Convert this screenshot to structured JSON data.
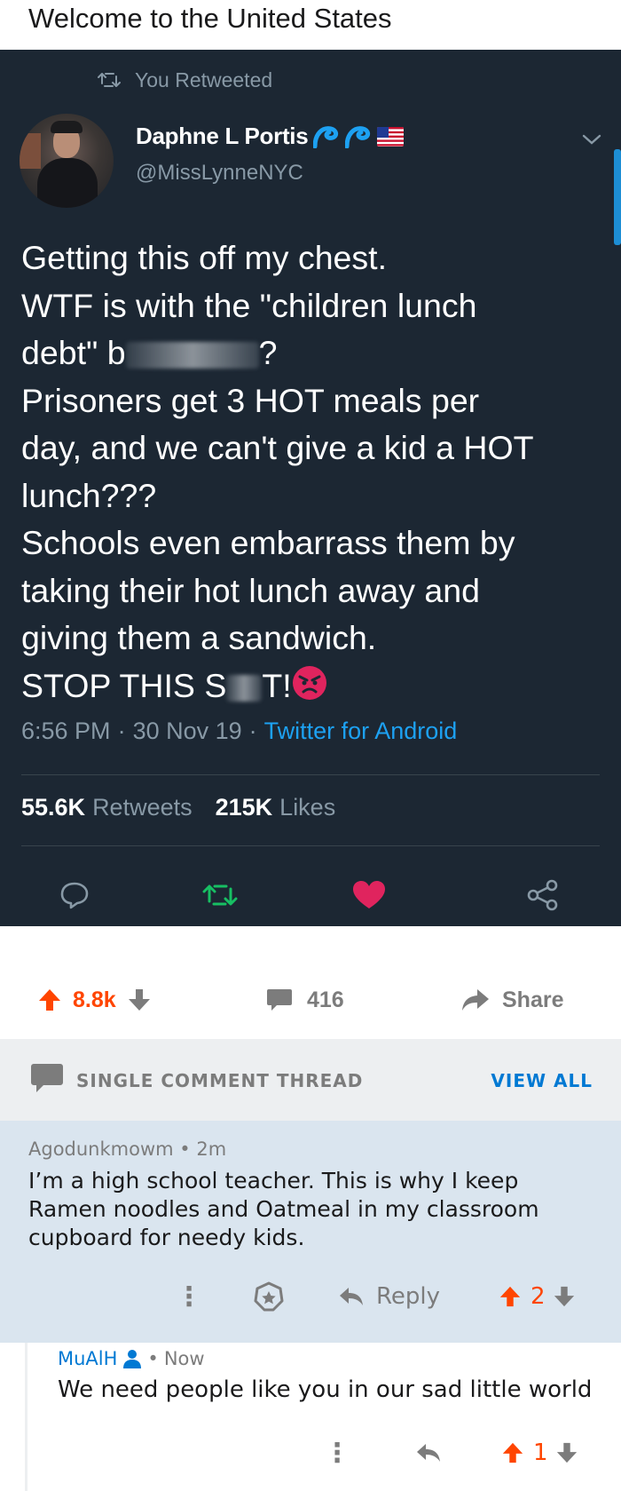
{
  "post": {
    "title": "Welcome to the United States"
  },
  "tweet": {
    "retweet_label": "You Retweeted",
    "author_name": "Daphne L Portis",
    "author_handle": "@MissLynneNYC",
    "lines": [
      "Getting this off my chest.",
      "WTF is with the \"children lunch",
      "?",
      "Prisoners get 3 HOT meals per",
      "day, and we can't give a kid a HOT",
      "lunch???",
      "Schools even embarrass them by",
      "taking their hot lunch away and",
      "giving them a sandwich."
    ],
    "line3_start": "debt\" b",
    "line10_start": "STOP THIS S",
    "line10_end": "T!",
    "time": "6:56 PM",
    "dot1": "·",
    "date": "30 Nov 19",
    "dot2": "·",
    "source": "Twitter for Android",
    "retweets_count": "55.6K",
    "retweets_label": "Retweets",
    "likes_count": "215K",
    "likes_label": "Likes",
    "icons": [
      "reply-icon",
      "retweet-icon",
      "heart-icon",
      "share-icon"
    ],
    "colors": {
      "background": "#1c2733",
      "accent": "#1da1f2",
      "retweet_green": "#17bf63",
      "like_pink": "#e0245e"
    }
  },
  "post_actions": {
    "score": "8.8k",
    "comments": "416",
    "share_label": "Share"
  },
  "thread": {
    "label": "SINGLE COMMENT THREAD",
    "view_all": "VIEW ALL"
  },
  "comment1": {
    "author": "Agodunkmowm",
    "separator": "•",
    "age": "2m",
    "body": "I’m a high school teacher.  This is why I keep Ramen noodles and Oatmeal in my classroom cupboard for needy kids.",
    "more": "⋮",
    "reply_label": "Reply",
    "score": "2"
  },
  "comment2": {
    "author": "MuAlH",
    "separator": "•",
    "age": "Now",
    "body": "We need people like you in our sad little world",
    "more": "⋮",
    "score": "1"
  },
  "reddit_colors": {
    "upvote": "#ff4500",
    "link": "#0079d3",
    "highlight": "#dae5ef"
  }
}
